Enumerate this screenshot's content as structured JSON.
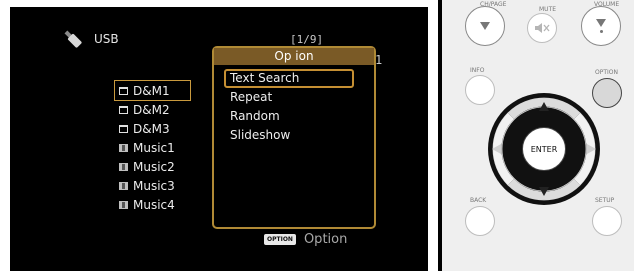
{
  "screen": {
    "source_label": "USB",
    "page_counter": "[1/9]",
    "page_suffix": "1",
    "files": [
      {
        "name": "D&M1",
        "type": "folder",
        "icon": "folder-icon"
      },
      {
        "name": "D&M2",
        "type": "folder",
        "icon": "folder-icon"
      },
      {
        "name": "D&M3",
        "type": "folder",
        "icon": "folder-icon"
      },
      {
        "name": "Music1",
        "type": "music",
        "icon": "music-file-icon"
      },
      {
        "name": "Music2",
        "type": "music",
        "icon": "music-file-icon"
      },
      {
        "name": "Music3",
        "type": "music",
        "icon": "music-file-icon"
      },
      {
        "name": "Music4",
        "type": "music",
        "icon": "music-file-icon"
      }
    ],
    "option_popup": {
      "title": "Op ion",
      "items": [
        "Text Search",
        "Repeat",
        "Random",
        "Slideshow"
      ],
      "highlighted_item": "Text Search"
    },
    "option_hint": {
      "badge": "OPTION",
      "label": "Option"
    }
  },
  "remote": {
    "labels": {
      "ch_page": "CH/PAGE",
      "mute": "MUTE",
      "volume": "VOLUME",
      "info": "INFO",
      "option": "OPTION",
      "enter": "ENTER",
      "back": "BACK",
      "setup": "SETUP"
    },
    "icons": {
      "ch_page_down": "down-triangle-icon",
      "mute": "mute-icon",
      "volume_down": "volume-down-icon",
      "usb": "usb-icon"
    }
  },
  "colors": {
    "popup_border": "#b08a35",
    "popup_title_bg": "#7a5a26",
    "highlight": "#c58f33"
  }
}
